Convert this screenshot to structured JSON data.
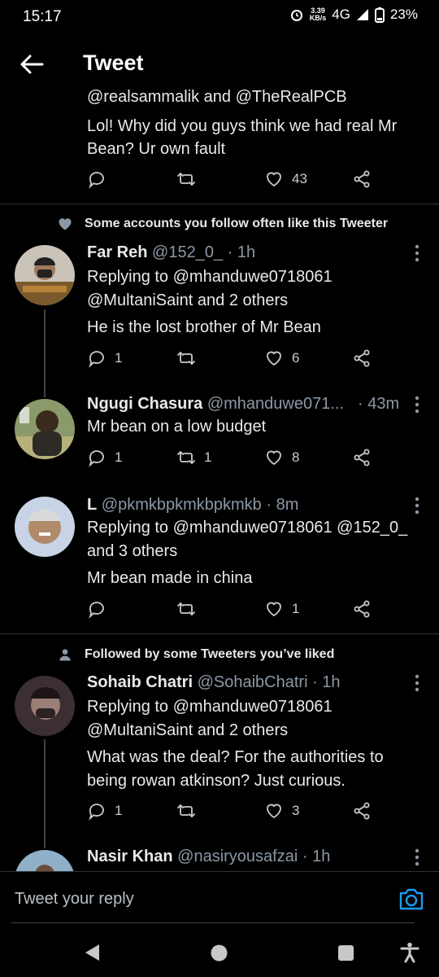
{
  "status_bar": {
    "time": "15:17",
    "net_speed_value": "3.39",
    "net_speed_unit": "KB/s",
    "network": "4G",
    "battery": "23%"
  },
  "header": {
    "title": "Tweet"
  },
  "top_tweet": {
    "partial_line": "@realsammalik and @TheRealPCB",
    "text": [
      "Lol! Why did you guys think we had real Mr",
      "Bean? Ur own fault"
    ],
    "likes": "43"
  },
  "sections": [
    {
      "social_context": "Some accounts you follow often like this Tweeter"
    },
    {
      "social_context": "Followed by some Tweeters you’ve liked"
    }
  ],
  "replies": [
    {
      "name": "Far Reh",
      "handle": "@152_0_",
      "time": "· 1h",
      "replying": [
        "Replying to @mhanduwe0718061",
        "@MultaniSaint and 2 others"
      ],
      "text": [
        "He is the lost brother of Mr Bean"
      ],
      "replies_count": "1",
      "retweets": "",
      "likes": "6"
    },
    {
      "name": "Ngugi Chasura",
      "handle": "@mhanduwe071...",
      "time": "· 43m",
      "replying": [],
      "text": [
        "Mr bean on a low budget"
      ],
      "replies_count": "1",
      "retweets": "1",
      "likes": "8"
    },
    {
      "name": "L",
      "handle": "@pkmkbpkmkbpkmkb",
      "time": "· 8m",
      "replying": [
        "Replying to @mhanduwe0718061 @152_0_",
        "and 3 others"
      ],
      "text": [
        "Mr bean made in china"
      ],
      "replies_count": "",
      "retweets": "",
      "likes": "1"
    },
    {
      "name": "Sohaib Chatri",
      "handle": "@SohaibChatri",
      "time": "· 1h",
      "replying": [
        "Replying to @mhanduwe0718061",
        "@MultaniSaint and 2 others"
      ],
      "text": [
        "What was the deal? For the authorities to",
        "being rowan atkinson? Just curious."
      ],
      "replies_count": "1",
      "retweets": "",
      "likes": "3"
    },
    {
      "name": "Nasir Khan",
      "handle": "@nasiryousafzai",
      "time": "· 1h"
    }
  ],
  "reply_bar": {
    "placeholder": "Tweet your reply"
  },
  "icons": {
    "reply": "reply-icon",
    "retweet": "retweet-icon",
    "like": "heart-icon",
    "share": "share-icon",
    "more": "more-vertical-icon",
    "back": "arrow-left-icon",
    "camera": "camera-icon",
    "social_heart": "heart-icon",
    "social_person": "person-icon"
  },
  "colors": {
    "background": "#000000",
    "text": "#e7e9ea",
    "muted": "#8b98a5",
    "accent": "#1d9bf0",
    "divider": "#2f3336"
  }
}
